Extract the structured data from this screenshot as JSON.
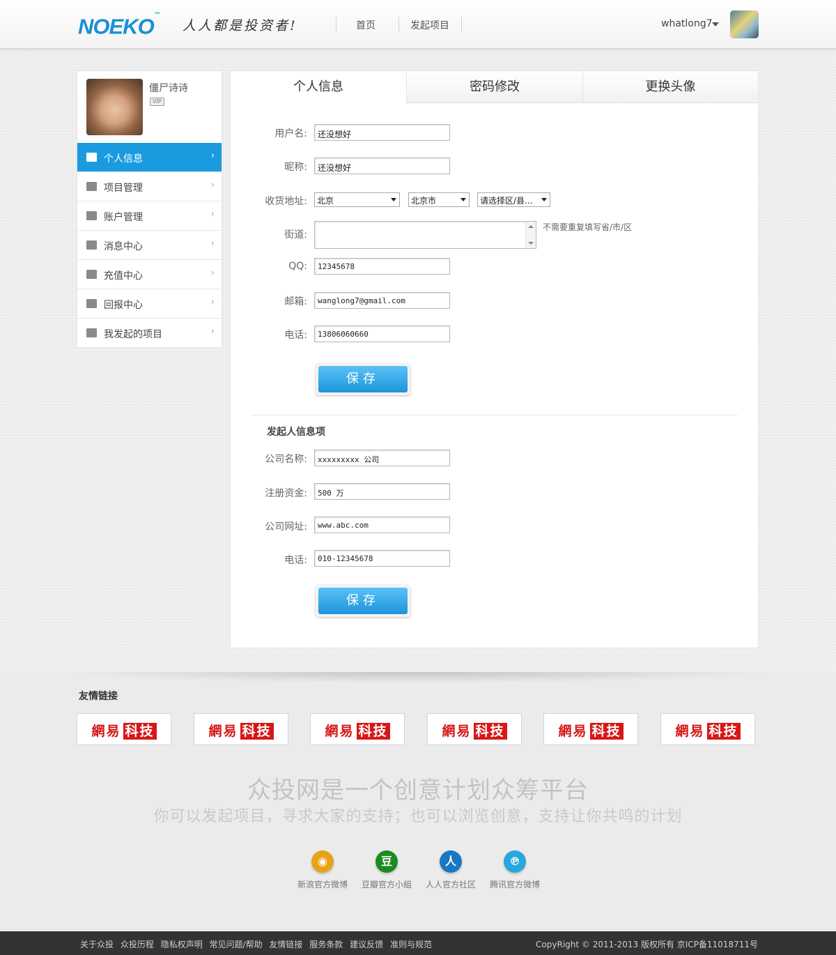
{
  "header": {
    "logo": "NOEKO",
    "logo_tm": "™",
    "slogan": "人人都是投资者!",
    "nav": [
      "首页",
      "发起项目"
    ],
    "username": "whatlong7"
  },
  "sidebar": {
    "profile_name": "僵尸诗诗",
    "vip_badge": "VIP",
    "items": [
      {
        "label": "个人信息",
        "icon": "user-icon"
      },
      {
        "label": "项目管理",
        "icon": "list-icon"
      },
      {
        "label": "账户管理",
        "icon": "account-icon"
      },
      {
        "label": "消息中心",
        "icon": "message-icon"
      },
      {
        "label": "充值中心",
        "icon": "card-icon"
      },
      {
        "label": "回报中心",
        "icon": "gift-icon"
      },
      {
        "label": "我发起的项目",
        "icon": "flag-icon"
      }
    ],
    "arrow": "›"
  },
  "tabs": [
    "个人信息",
    "密码修改",
    "更换头像"
  ],
  "form": {
    "username_label": "用户名:",
    "username_value": "还没想好",
    "nickname_label": "昵称:",
    "nickname_value": "还没想好",
    "address_label": "收货地址:",
    "province": "北京",
    "city": "北京市",
    "district": "请选择区/县...",
    "street_label": "街道:",
    "street_hint": "不需要重复填写省/市/区",
    "qq_label": "QQ:",
    "qq_value": "12345678",
    "email_label": "邮箱:",
    "email_value": "wanglong7@gmail.com",
    "phone_label": "电话:",
    "phone_value": "13806060660",
    "save_label": "保存"
  },
  "founder": {
    "section_title": "发起人信息项",
    "company_label": "公司名称:",
    "company_value": "xxxxxxxxx 公司",
    "capital_label": "注册资金:",
    "capital_value": "500 万",
    "website_label": "公司网址:",
    "website_value": "www.abc.com",
    "phone_label": "电话:",
    "phone_value": "010-12345678",
    "save_label": "保存"
  },
  "footer": {
    "friend_links_title": "友情链接",
    "friend_link_text_a": "網易",
    "friend_link_text_b": "科技",
    "headline": "众投网是一个创意计划众筹平台",
    "subline": "你可以发起项目，寻求大家的支持；也可以浏览创意，支持让你共鸣的计划",
    "socials": [
      {
        "label": "新浪官方微博",
        "glyph": "◉",
        "color": "#e8a21a"
      },
      {
        "label": "豆瓣官方小組",
        "glyph": "豆",
        "color": "#1f8a1f"
      },
      {
        "label": "人人官方社区",
        "glyph": "人",
        "color": "#1a78c2"
      },
      {
        "label": "腾讯官方微博",
        "glyph": "℗",
        "color": "#29a6dd"
      }
    ],
    "bottom_links": [
      "关于众投",
      "众投历程",
      "隐私权声明",
      "常见问题/帮助",
      "友情链接",
      "服务条款",
      "建议反馈",
      "准则与规范"
    ],
    "copyright": "CopyRight © 2011-2013    版权所有  京ICP备11018711号"
  },
  "colors": {
    "accent": "#1a9be0",
    "brand_red": "#d71818"
  }
}
